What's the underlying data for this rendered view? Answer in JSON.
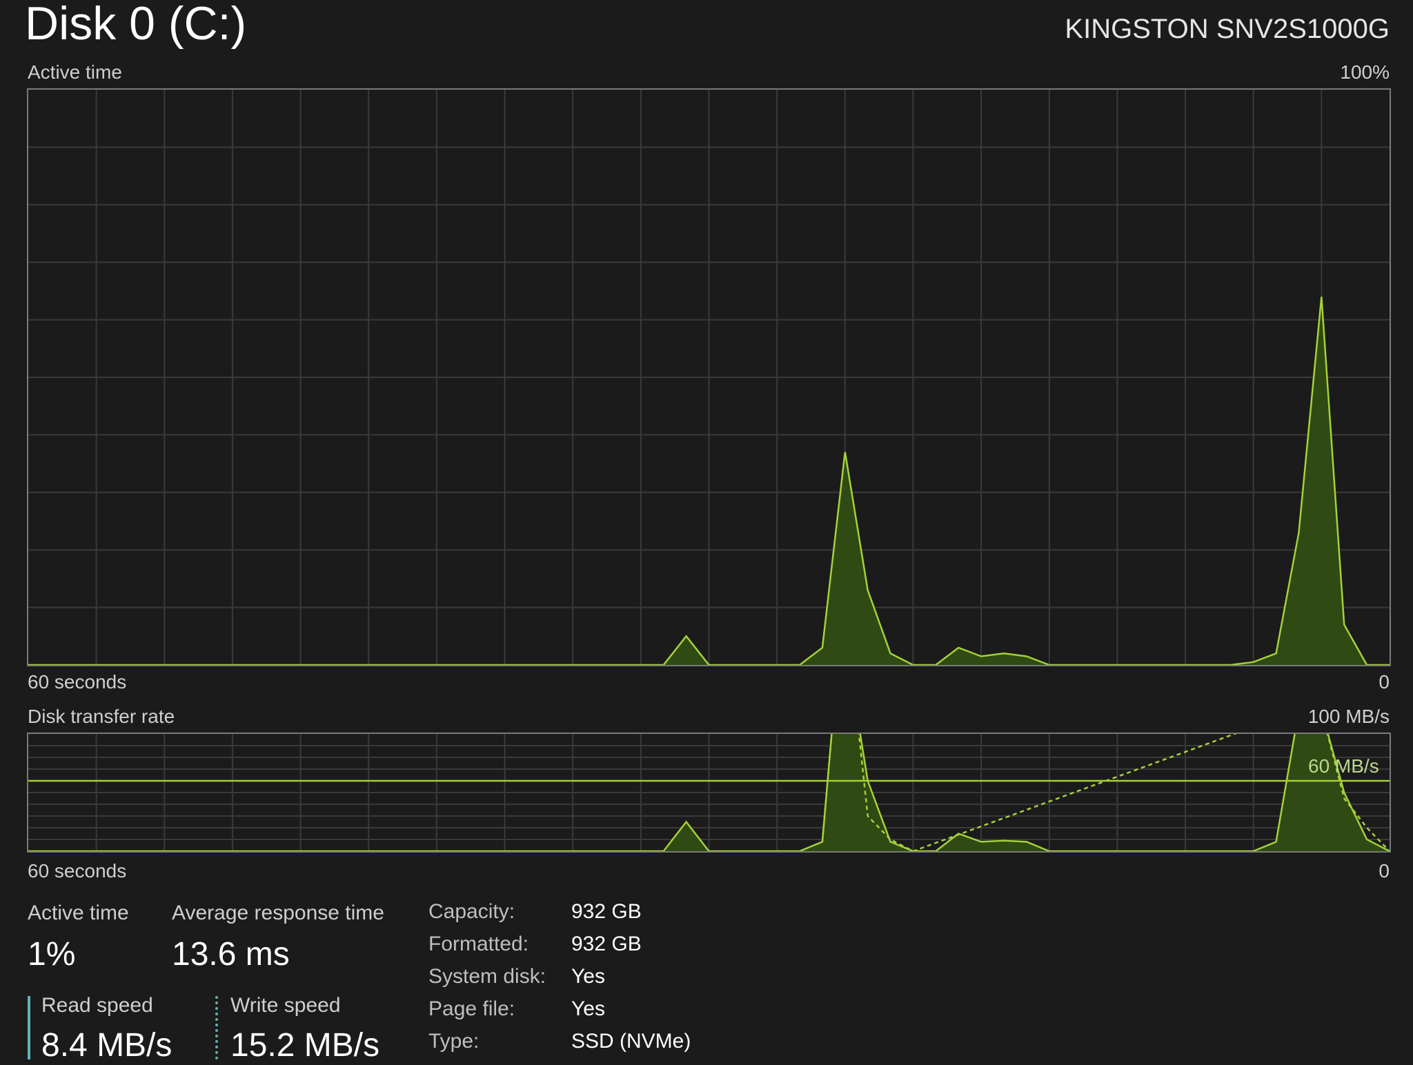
{
  "header": {
    "title": "Disk 0 (C:)",
    "model": "KINGSTON SNV2S1000G"
  },
  "active_time_graph": {
    "label": "Active time",
    "max_label": "100%",
    "x_left_label": "60 seconds",
    "x_right_label": "0"
  },
  "transfer_graph": {
    "label": "Disk transfer rate",
    "max_label": "100 MB/s",
    "ref_line_label": "60 MB/s",
    "x_left_label": "60 seconds",
    "x_right_label": "0"
  },
  "stats": {
    "active_time_label": "Active time",
    "active_time_value": "1%",
    "response_label": "Average response time",
    "response_value": "13.6 ms",
    "read_label": "Read speed",
    "read_value": "8.4 MB/s",
    "write_label": "Write speed",
    "write_value": "15.2 MB/s"
  },
  "properties": [
    {
      "key": "Capacity:",
      "value": "932 GB"
    },
    {
      "key": "Formatted:",
      "value": "932 GB"
    },
    {
      "key": "System disk:",
      "value": "Yes"
    },
    {
      "key": "Page file:",
      "value": "Yes"
    },
    {
      "key": "Type:",
      "value": "SSD (NVMe)"
    }
  ],
  "colors": {
    "line": "#a6d13a",
    "fill": "#2f4a12",
    "grid": "#3a3a3a",
    "border": "#7a7a7a",
    "accent_bar": "#5fb4b4"
  },
  "chart_data": [
    {
      "type": "area",
      "title": "Active time",
      "ylim": [
        0,
        100
      ],
      "x_range_seconds": [
        60,
        0
      ],
      "series": [
        {
          "x": [
            60,
            32,
            31,
            30,
            26,
            25,
            24,
            23,
            22,
            21,
            20,
            19,
            18,
            17,
            16,
            15,
            14,
            13,
            12,
            11,
            10,
            7,
            6,
            5,
            4,
            3,
            2,
            1,
            0
          ],
          "values": [
            0,
            0,
            5,
            0,
            0,
            3,
            37,
            13,
            2,
            0,
            0,
            3,
            1.5,
            2,
            1.5,
            0,
            0,
            0,
            0,
            0,
            0,
            0,
            0.5,
            2,
            23,
            64,
            7,
            0,
            0
          ]
        }
      ]
    },
    {
      "type": "area",
      "title": "Disk transfer rate",
      "ylim": [
        0,
        100
      ],
      "reference_line": 60,
      "series": [
        {
          "x": [
            60,
            32,
            31,
            30,
            26,
            25,
            24.5,
            23.5,
            23,
            22,
            21,
            20,
            19,
            18,
            17,
            16,
            15,
            14,
            13,
            12,
            11,
            10,
            7,
            6,
            5,
            4,
            3,
            2,
            1,
            0
          ],
          "values": [
            0,
            0,
            25,
            0,
            0,
            8,
            120,
            120,
            60,
            8,
            0,
            0,
            15,
            8,
            9,
            8,
            0,
            0,
            0,
            0,
            0,
            0,
            0,
            0,
            8,
            120,
            120,
            50,
            10,
            0
          ]
        },
        {
          "x": [
            25,
            24.5,
            23.5,
            23,
            22,
            21,
            4,
            3,
            2,
            1,
            0
          ],
          "values": [
            8,
            120,
            120,
            30,
            10,
            0,
            120,
            120,
            45,
            20,
            0
          ]
        }
      ]
    }
  ]
}
